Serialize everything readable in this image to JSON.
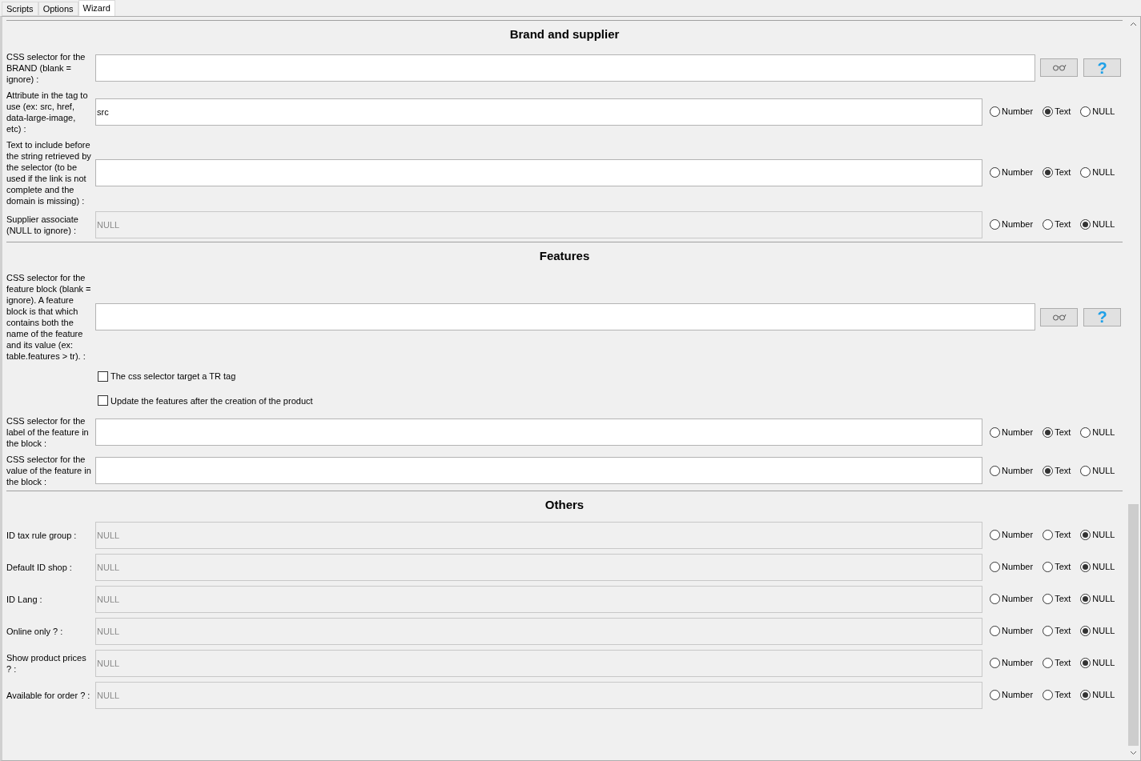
{
  "tabs": [
    {
      "label": "Scripts",
      "selected": false
    },
    {
      "label": "Options",
      "selected": false
    },
    {
      "label": "Wizard",
      "selected": true
    }
  ],
  "sections": [
    {
      "title": "Brand and supplier",
      "rows": [
        {
          "kind": "field",
          "label": "CSS selector for the BRAND (blank = ignore) :",
          "disabled": false,
          "buttons": [
            {
              "kind": "view"
            },
            {
              "kind": "help",
              "label": "?"
            }
          ]
        },
        {
          "kind": "field",
          "label": "Attribute in the tag to use (ex: src, href, data-large-image, etc) :",
          "value": "src",
          "disabled": false,
          "options": [
            {
              "label": "Number",
              "selected": false
            },
            {
              "label": "Text",
              "selected": true
            },
            {
              "label": "NULL",
              "selected": false
            }
          ]
        },
        {
          "kind": "field",
          "label": "Text to include before the string retrieved by the selector (to be used if the link is not complete and the domain is missing) :",
          "disabled": false,
          "options": [
            {
              "label": "Number",
              "selected": false
            },
            {
              "label": "Text",
              "selected": true
            },
            {
              "label": "NULL",
              "selected": false
            }
          ]
        },
        {
          "kind": "field",
          "label": "Supplier associate (NULL to ignore) :",
          "value": "NULL",
          "disabled": true,
          "options": [
            {
              "label": "Number",
              "selected": false
            },
            {
              "label": "Text",
              "selected": false
            },
            {
              "label": "NULL",
              "selected": true
            }
          ]
        }
      ]
    },
    {
      "title": "Features",
      "rows": [
        {
          "kind": "field",
          "label": "CSS selector for the feature block (blank = ignore). A feature block is that which contains both the name of the feature and its value (ex: table.features > tr). :",
          "disabled": false,
          "buttons": [
            {
              "kind": "view"
            },
            {
              "kind": "help",
              "label": "?"
            }
          ]
        },
        {
          "kind": "checkbox",
          "label": "The css selector target a TR tag",
          "checked": false
        },
        {
          "kind": "checkbox",
          "label": "Update the features after the creation of the product",
          "checked": false
        },
        {
          "kind": "field",
          "label": "CSS selector for the label of the feature in the block :",
          "disabled": false,
          "options": [
            {
              "label": "Number",
              "selected": false
            },
            {
              "label": "Text",
              "selected": true
            },
            {
              "label": "NULL",
              "selected": false
            }
          ]
        },
        {
          "kind": "field",
          "label": "CSS selector for the value of the feature in the block :",
          "disabled": false,
          "options": [
            {
              "label": "Number",
              "selected": false
            },
            {
              "label": "Text",
              "selected": true
            },
            {
              "label": "NULL",
              "selected": false
            }
          ]
        }
      ]
    },
    {
      "title": "Others",
      "rows": [
        {
          "kind": "field",
          "label": "ID tax rule group :",
          "value": "NULL",
          "disabled": true,
          "options": [
            {
              "label": "Number",
              "selected": false
            },
            {
              "label": "Text",
              "selected": false
            },
            {
              "label": "NULL",
              "selected": true
            }
          ]
        },
        {
          "kind": "field",
          "label": "Default ID shop :",
          "value": "NULL",
          "disabled": true,
          "options": [
            {
              "label": "Number",
              "selected": false
            },
            {
              "label": "Text",
              "selected": false
            },
            {
              "label": "NULL",
              "selected": true
            }
          ]
        },
        {
          "kind": "field",
          "label": "ID Lang :",
          "value": "NULL",
          "disabled": true,
          "options": [
            {
              "label": "Number",
              "selected": false
            },
            {
              "label": "Text",
              "selected": false
            },
            {
              "label": "NULL",
              "selected": true
            }
          ]
        },
        {
          "kind": "field",
          "label": "Online only ? :",
          "value": "NULL",
          "disabled": true,
          "options": [
            {
              "label": "Number",
              "selected": false
            },
            {
              "label": "Text",
              "selected": false
            },
            {
              "label": "NULL",
              "selected": true
            }
          ]
        },
        {
          "kind": "field",
          "label": "Show product prices ? :",
          "value": "NULL",
          "disabled": true,
          "options": [
            {
              "label": "Number",
              "selected": false
            },
            {
              "label": "Text",
              "selected": false
            },
            {
              "label": "NULL",
              "selected": true
            }
          ]
        },
        {
          "kind": "field",
          "label": "Available for order ? :",
          "value": "NULL",
          "disabled": true,
          "options": [
            {
              "label": "Number",
              "selected": false
            },
            {
              "label": "Text",
              "selected": false
            },
            {
              "label": "NULL",
              "selected": true
            }
          ]
        }
      ]
    }
  ]
}
